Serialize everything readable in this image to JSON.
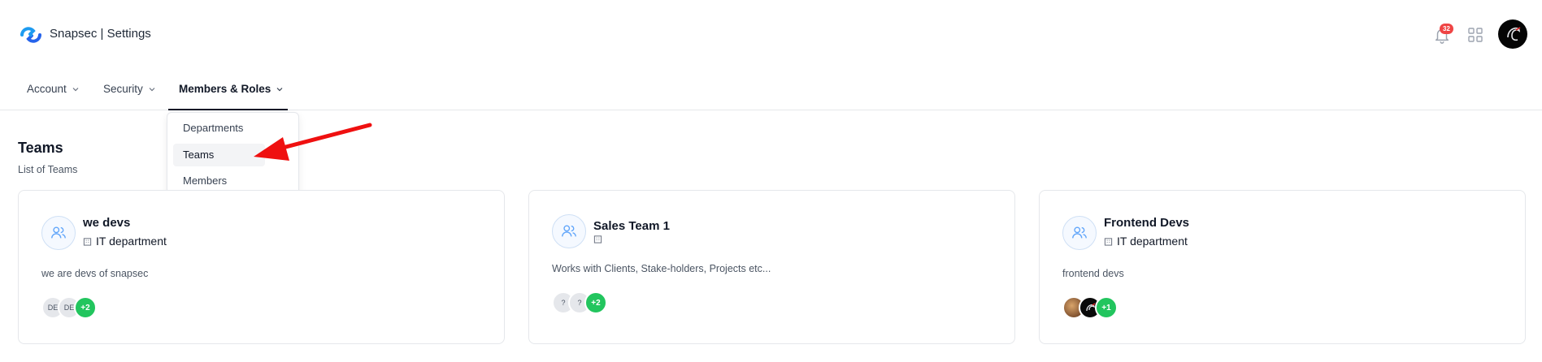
{
  "header": {
    "app_title": "Snapsec | Settings",
    "notification_count": "32",
    "brand_color": "#2563eb"
  },
  "tabs": [
    {
      "label": "Account",
      "active": false
    },
    {
      "label": "Security",
      "active": false
    },
    {
      "label": "Members & Roles",
      "active": true
    }
  ],
  "dropdown": {
    "items": [
      {
        "label": "Departments"
      },
      {
        "label": "Teams",
        "hover": true
      },
      {
        "label": "Members"
      }
    ]
  },
  "section": {
    "title": "Teams",
    "subtitle": "List of Teams"
  },
  "teams": [
    {
      "name": "we devs",
      "department": "IT department",
      "description": "we are devs of snapsec",
      "member_avatars": [
        "DE",
        "DE"
      ],
      "extra_members": "+2"
    },
    {
      "name": "Sales Team 1",
      "department": "",
      "description": "Works with Clients, Stake-holders, Projects etc...",
      "member_avatars": [
        "?",
        "?"
      ],
      "extra_members": "+2"
    },
    {
      "name": "Frontend Devs",
      "department": "IT department",
      "description": "frontend devs",
      "member_avatars": [
        "photo",
        "photo"
      ],
      "extra_members": "+1"
    }
  ],
  "colors": {
    "accent_green": "#22c55e",
    "badge_red": "#ef4444",
    "annotation_arrow": "#ef1010"
  }
}
